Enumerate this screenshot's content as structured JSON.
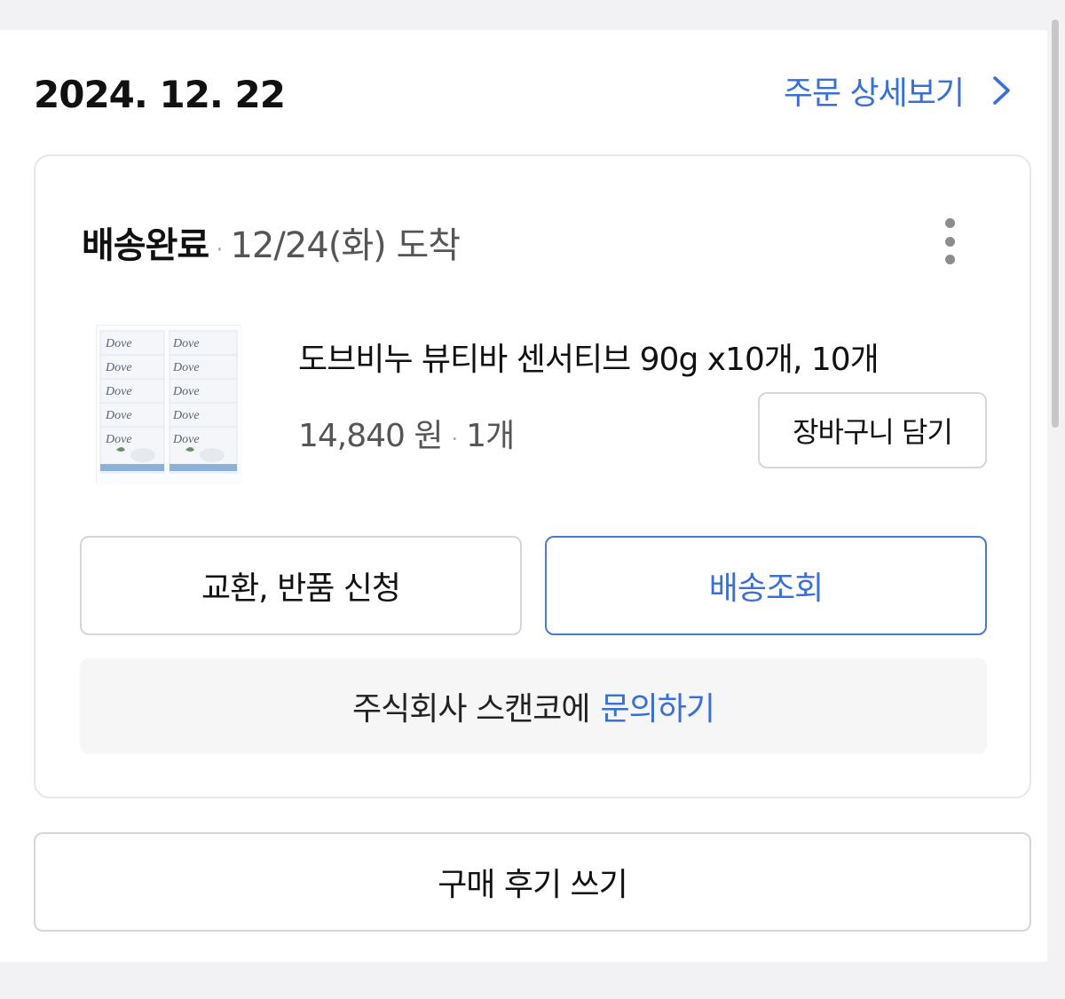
{
  "order": {
    "date": "2024. 12. 22",
    "detail_link_label": "주문 상세보기"
  },
  "shipment": {
    "status_label": "배송완료",
    "status_separator": "·",
    "arrival_text": "12/24(화) 도착"
  },
  "product": {
    "name": "도브비누 뷰티바 센서티브 90g x10개, 10개",
    "price": "14,840 원",
    "price_separator": "·",
    "quantity": "1개",
    "thumbnail_brand": "Dove"
  },
  "buttons": {
    "add_to_cart": "장바구니 담기",
    "return_exchange": "교환, 반품 신청",
    "track_delivery": "배송조회",
    "write_review": "구매 후기 쓰기"
  },
  "inquiry": {
    "prefix": "주식회사 스캔코에",
    "link_label": "문의하기"
  },
  "colors": {
    "accent_blue": "#3a6fd8",
    "page_bg": "#f2f2f4"
  },
  "icons": {
    "detail": "chevron-right-icon",
    "more": "more-vertical-icon"
  }
}
